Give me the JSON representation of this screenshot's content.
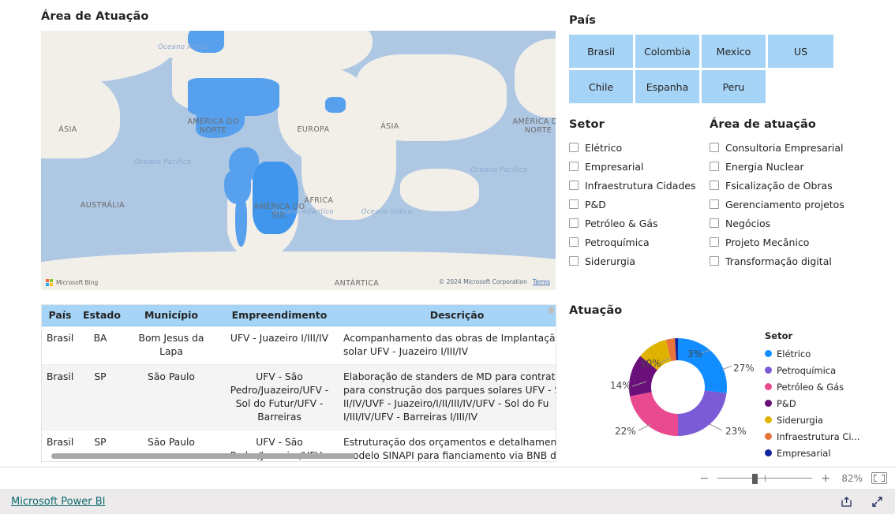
{
  "map": {
    "title": "Área de Atuação",
    "continents": [
      "ÁSIA",
      "AMÉRICA DO NORTE",
      "EUROPA",
      "ÁSIA",
      "AMÉRICA DO NORTE",
      "ÁFRICA",
      "AUSTRÁLIA",
      "AMÉRICA DO SUL",
      "ANTÁRTICA"
    ],
    "oceans": [
      "Oceano Ártico",
      "Oceano Pacífico",
      "Oceano Atlântico",
      "Oceano Pacífico",
      "Oceano Índico"
    ],
    "labels": {
      "asia_left": "ÁSIA",
      "north_america_left": "AMÉRICA DO NORTE",
      "europa": "EUROPA",
      "asia_right": "ÁSIA",
      "north_america_right": "AMÉRICA DO NORTE",
      "africa": "ÁFRICA",
      "australia": "AUSTRÁLIA",
      "south_america": "AMÉRICA DO SUL",
      "antarctica": "ANTÁRTICA",
      "oceano_artico": "Oceano Ártico",
      "oceano_pacifico_1": "Oceano Pacífico",
      "oceano_atlantico": "Oceano Atlântico",
      "oceano_pacifico_2": "Oceano Pacífico",
      "oceano_indico": "Oceano Índico"
    },
    "bing_logo_text": "Microsoft Bing",
    "attribution": "© 2024 Microsoft Corporation",
    "terms_label": "Terms",
    "highlight_color": "#57a0ee"
  },
  "pais_slicer": {
    "title": "País",
    "buttons": [
      {
        "label": "Brasil"
      },
      {
        "label": "Colombia"
      },
      {
        "label": "Mexico"
      },
      {
        "label": "US"
      },
      {
        "label": "Chile"
      },
      {
        "label": "Espanha"
      },
      {
        "label": "Peru"
      }
    ],
    "button_color": "#a6d4f7"
  },
  "setor_slicer": {
    "title": "Setor",
    "items": [
      {
        "label": "Elétrico",
        "checked": false
      },
      {
        "label": "Empresarial",
        "checked": false
      },
      {
        "label": "Infraestrutura Cidades",
        "checked": false
      },
      {
        "label": "P&D",
        "checked": false
      },
      {
        "label": "Petróleo & Gás",
        "checked": false
      },
      {
        "label": "Petroquímica",
        "checked": false
      },
      {
        "label": "Siderurgia",
        "checked": false
      }
    ]
  },
  "area_slicer": {
    "title": "Área de atuação",
    "items": [
      {
        "label": "Consultoria Empresarial",
        "checked": false
      },
      {
        "label": "Energia Nuclear",
        "checked": false
      },
      {
        "label": "Fsicalização de Obras",
        "checked": false
      },
      {
        "label": "Gerenciamento projetos",
        "checked": false
      },
      {
        "label": "Negócios",
        "checked": false
      },
      {
        "label": "Projeto Mecânico",
        "checked": false
      },
      {
        "label": "Transformação digital",
        "checked": false
      }
    ]
  },
  "table": {
    "headers": [
      "País",
      "Estado",
      "Município",
      "Empreendimento",
      "Descrição"
    ],
    "rows": [
      {
        "pais": "Brasil",
        "estado": "BA",
        "municipio": "Bom Jesus da Lapa",
        "empreendimento": "UFV - Juazeiro I/III/IV",
        "descricao": "Acompanhamento das obras de Implantação solar UFV - Juazeiro I/III/IV"
      },
      {
        "pais": "Brasil",
        "estado": "SP",
        "municipio": "São Paulo",
        "empreendimento": "UFV - São Pedro/Juazeiro/UFV - Sol do Futur/UFV - Barreiras",
        "descricao": "Elaboração de standers de MD para contrata para construção dos parques solares UFV - S II/IV/UVF - Juazeiro/I/II/III/IV/UFV - Sol do Fu I/III/IV/UFV - Barreiras I/III/IV"
      },
      {
        "pais": "Brasil",
        "estado": "SP",
        "municipio": "São Paulo",
        "empreendimento": "UFV - São Pedro/Juazeiro/UFV - Sol do Futur/UFV -",
        "descricao": "Estruturação dos orçamentos e detalhament modelo SINAPI para fianciamento via BNB d solares UFV - São Pedro II/IV/UVF -"
      }
    ],
    "header_color": "#a6d4f7"
  },
  "donut": {
    "title": "Atuação",
    "legend_title": "Setor"
  },
  "chart_data": {
    "type": "pie",
    "title": "Atuação",
    "legend_title": "Setor",
    "legend_position": "right",
    "categories": [
      "Elétrico",
      "Petroquímica",
      "Petróleo & Gás",
      "P&D",
      "Siderurgia",
      "Infraestrutura Ci...",
      "Empresarial"
    ],
    "values": [
      27,
      23,
      22,
      14,
      10,
      3,
      1
    ],
    "value_labels": [
      "27%",
      "23%",
      "22%",
      "14%",
      "10%",
      "3%",
      ""
    ],
    "colors": [
      "#118DFF",
      "#7B5BD6",
      "#E9498F",
      "#6B0F7A",
      "#E0B200",
      "#E8743B",
      "#12239E"
    ],
    "unit": "%",
    "donut_hole": true
  },
  "status_bar": {
    "zoom_minus": "−",
    "zoom_plus": "+",
    "zoom_level": "82%",
    "fit_label": "fit-to-page-icon"
  },
  "footer": {
    "brand_link": "Microsoft Power BI",
    "share_icon": "share-icon",
    "fullscreen_icon": "fullscreen-icon"
  }
}
